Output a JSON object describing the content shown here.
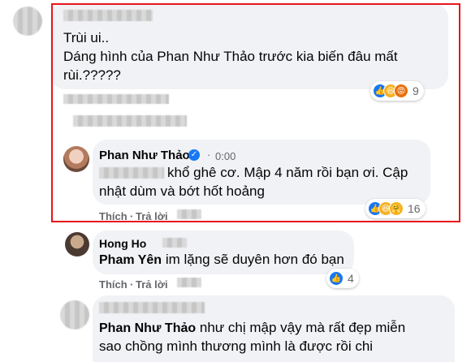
{
  "comment1": {
    "text_line1": "Trùi ui..",
    "text_line2": "Dáng hình của Phan Như Thảo trước kia biến đâu mất",
    "text_line3": "rùi.?????",
    "reaction_count": "9",
    "reaction_icons": [
      "like-icon",
      "haha-icon",
      "angry-icon"
    ]
  },
  "reply1": {
    "author": "Phan Như Thảo",
    "verified_badge": "✓",
    "timestamp": "0:00",
    "text_line1": "khổ ghê cơ. Mập 4 năm rồi bạn ơi. Cập",
    "text_line2": "nhật dùm và bớt hốt hoảng",
    "reaction_count": "16",
    "reaction_icons": [
      "like-icon",
      "haha-icon",
      "care-icon"
    ],
    "actions": {
      "like": "Thích",
      "reply": "Trả lời"
    },
    "separator": "·"
  },
  "reply2": {
    "author": "Hong Ho",
    "mention": "Pham Yên",
    "text": "im lặng sẽ duyên hơn đó bạn",
    "reaction_count": "4",
    "actions": {
      "like": "Thích",
      "reply": "Trả lời"
    },
    "separator": "·"
  },
  "reply3": {
    "mention": "Phan Như Thảo",
    "text_line1": "như chị mập vậy mà rất đẹp miễn",
    "text_line2": "sao chồng mình thương mình là được rồi chi"
  },
  "colors": {
    "highlight_border": "#e8141b",
    "bubble": "#f0f2f5",
    "like_blue": "#1877f2",
    "meta_gray": "#65676b"
  }
}
